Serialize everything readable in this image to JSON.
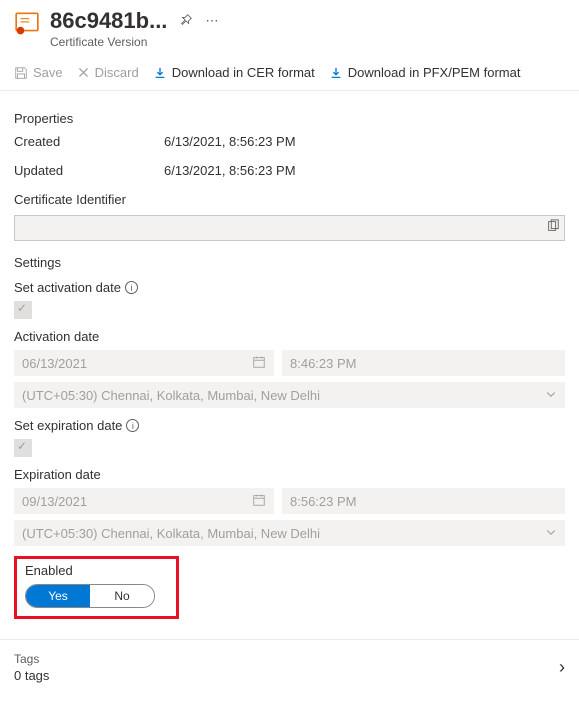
{
  "header": {
    "title": "86c9481b...",
    "subtitle": "Certificate Version"
  },
  "toolbar": {
    "save": "Save",
    "discard": "Discard",
    "download_cer": "Download in CER format",
    "download_pfx": "Download in PFX/PEM format"
  },
  "properties": {
    "heading": "Properties",
    "created_label": "Created",
    "created_value": "6/13/2021, 8:56:23 PM",
    "updated_label": "Updated",
    "updated_value": "6/13/2021, 8:56:23 PM",
    "identifier_label": "Certificate Identifier"
  },
  "settings": {
    "heading": "Settings",
    "activation_label": "Set activation date",
    "activation_date_label": "Activation date",
    "activation_date": "06/13/2021",
    "activation_time": "8:46:23 PM",
    "timezone": "(UTC+05:30) Chennai, Kolkata, Mumbai, New Delhi",
    "expiration_label": "Set expiration date",
    "expiration_date_label": "Expiration date",
    "expiration_date": "09/13/2021",
    "expiration_time": "8:56:23 PM",
    "enabled_label": "Enabled",
    "toggle_yes": "Yes",
    "toggle_no": "No"
  },
  "tags": {
    "label": "Tags",
    "value": "0 tags"
  }
}
